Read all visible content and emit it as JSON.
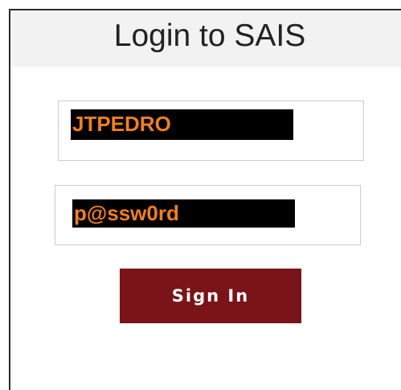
{
  "header": {
    "title": "Login to SAIS"
  },
  "form": {
    "username_value": "JTPEDRO",
    "password_value": "p@ssw0rd",
    "sign_in_label": "Sign In"
  },
  "colors": {
    "button_bg": "#7a1419",
    "value_text": "#f07f22",
    "header_bg": "#f2f2f2"
  }
}
